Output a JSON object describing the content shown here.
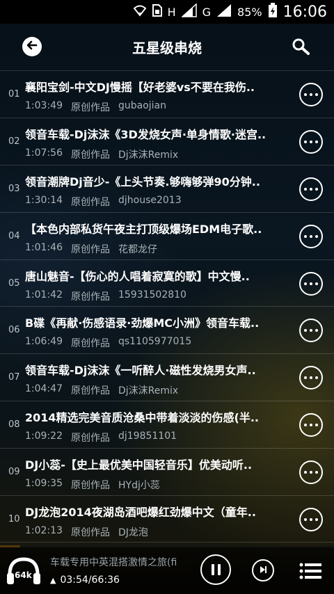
{
  "status_bar": {
    "network_h": "H",
    "network_g": "G",
    "battery": "85%",
    "time": "16:06"
  },
  "header": {
    "title": "五星级串烧"
  },
  "tracks": [
    {
      "index": "01",
      "title": "襄阳宝剑-中文DJ慢摇【好老婆vs不要在我伤..",
      "duration": "1:03:49",
      "type": "原创作品",
      "uploader": "gubaojian"
    },
    {
      "index": "02",
      "title": "领音车载-Dj沫沫《3D发烧女声·单身情歌·迷宫..",
      "duration": "1:07:56",
      "type": "原创作品",
      "uploader": "Dj沫沫Remix"
    },
    {
      "index": "03",
      "title": "领音潮牌Dj音少-《上头节奏.够嗨够弹90分钟..",
      "duration": "1:30:14",
      "type": "原创作品",
      "uploader": "djhouse2013"
    },
    {
      "index": "04",
      "title": "【本色内部私货午夜主打顶级爆场EDM电子歌..",
      "duration": "1:01:46",
      "type": "原创作品",
      "uploader": "花都龙仔"
    },
    {
      "index": "05",
      "title": "唐山魅音-【伤心的人唱着寂寞的歌】中文慢..",
      "duration": "1:01:42",
      "type": "原创作品",
      "uploader": "15931502810"
    },
    {
      "index": "06",
      "title": "B碟《再献·伤感语录·劲爆MC小洲》领音车载..",
      "duration": "1:06:49",
      "type": "原创作品",
      "uploader": "qs1105977015"
    },
    {
      "index": "07",
      "title": "领音车载-Dj沫沫《一听醉人·磁性发烧男女声..",
      "duration": "1:04:47",
      "type": "原创作品",
      "uploader": "Dj沫沫Remix"
    },
    {
      "index": "08",
      "title": "2014精选完美音质沧桑中带着淡淡的伤感(半..",
      "duration": "1:09:22",
      "type": "原创作品",
      "uploader": "dj19851101"
    },
    {
      "index": "09",
      "title": "DJ小蕊-【史上最优美中国轻音乐】优美动听..",
      "duration": "1:09:35",
      "type": "原创作品",
      "uploader": "HYdj小蕊"
    },
    {
      "index": "10",
      "title": "DJ龙泡2014夜湖岛酒吧爆红劲爆中文（童年..",
      "duration": "1:02:13",
      "type": "原创作品",
      "uploader": "DJ龙泡"
    }
  ],
  "player": {
    "quality": "64k",
    "now_playing": "车载专用中英混搭激情之旅(fi",
    "time": "03:54/66:36",
    "progress": 0.06
  },
  "colors": {
    "accent": "#f0a020",
    "meta_text": "#a9b2b8"
  },
  "icons": {
    "back": "back-arrow-icon",
    "search": "search-icon",
    "more": "more-icon",
    "pause": "pause-icon",
    "next": "next-icon",
    "menu": "menu-icon",
    "quality": "headphones-icon"
  }
}
